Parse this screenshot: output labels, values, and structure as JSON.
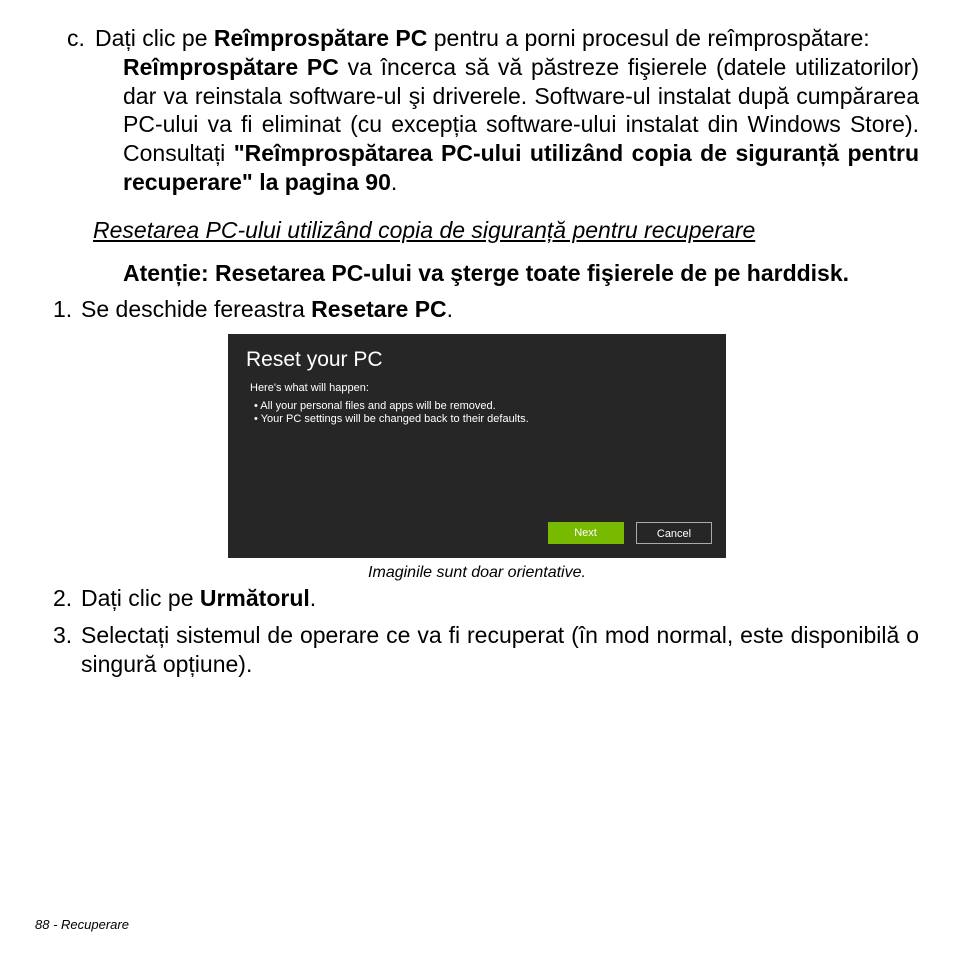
{
  "item_c": {
    "marker": "c.",
    "t1": "Dați clic pe ",
    "b1": "Reîmprospătare PC",
    "t2": " pentru a porni procesul de reîmprospătare:",
    "b2": "Reîmprospătare PC",
    "t3": " va încerca să vă păstreze fişierele (datele utilizatorilor) dar va reinstala software-ul şi driverele. Software-ul instalat după cumpărarea PC-ului va fi eliminat (cu excepția software-ului instalat din Windows Store). Consultați ",
    "b3": "\"Reîmprospătarea PC-ului utilizând copia de siguranță pentru recuperare\" la pagina 90",
    "t4": "."
  },
  "heading": "Resetarea PC-ului utilizând copia de siguranță pentru recuperare",
  "warning": "Atenție: Resetarea PC-ului va şterge toate fişierele de pe harddisk.",
  "steps": {
    "s1": {
      "num": "1.",
      "t1": "Se deschide fereastra ",
      "b1": "Resetare PC",
      "t2": "."
    },
    "s2": {
      "num": "2.",
      "t1": "Dați clic pe ",
      "b1": "Următorul",
      "t2": "."
    },
    "s3": {
      "num": "3.",
      "t1": "Selectați sistemul de operare ce va fi recuperat (în mod normal, este disponibilă o singură opțiune)."
    }
  },
  "dialog": {
    "title": "Reset your PC",
    "sub": "Here's what will happen:",
    "bullet1": "• All your personal files and apps will be removed.",
    "bullet2": "• Your PC settings will be changed back to their defaults.",
    "next": "Next",
    "cancel": "Cancel"
  },
  "caption": "Imaginile sunt doar orientative.",
  "footer": "88 - Recuperare"
}
